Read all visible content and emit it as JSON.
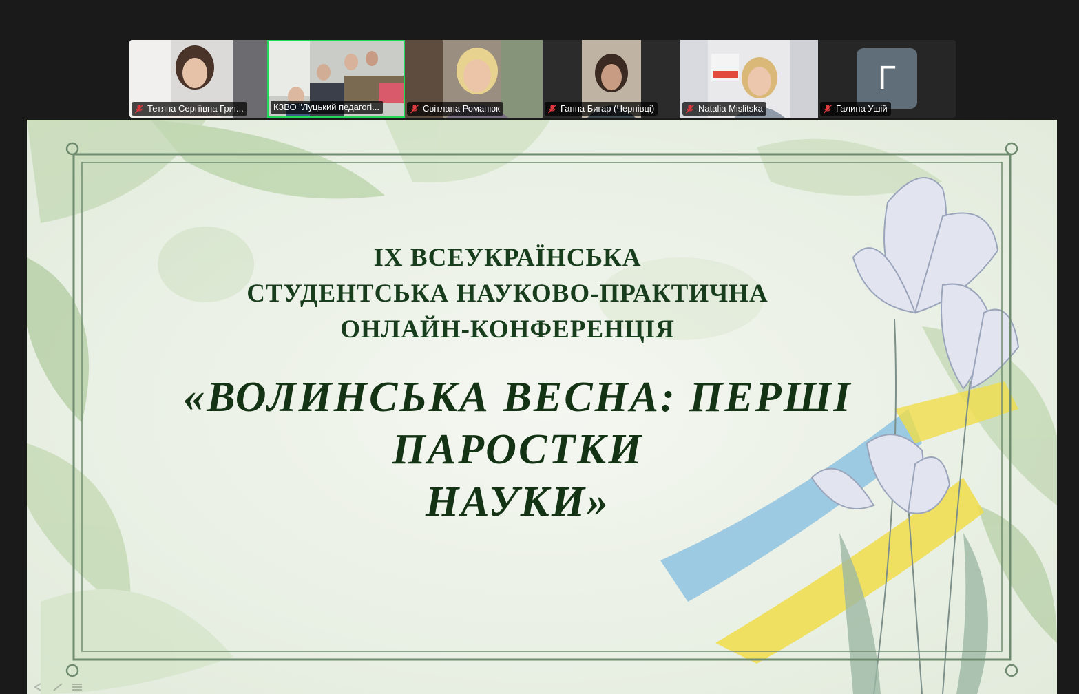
{
  "participants": [
    {
      "name": "Тетяна Сергіївна Григ...",
      "muted": true,
      "active": false
    },
    {
      "name": "КЗВО \"Луцький педагогі...",
      "muted": true,
      "active": true
    },
    {
      "name": "Світлана Романюк",
      "muted": true,
      "active": false
    },
    {
      "name": "Ганна Бигар (Чернівці)",
      "muted": true,
      "active": false
    },
    {
      "name": "Natalia Mislitska",
      "muted": true,
      "active": false
    },
    {
      "name": "Галина Ушій",
      "muted": true,
      "active": false,
      "avatar_letter": "Г"
    }
  ],
  "slide": {
    "line1": "IX ВСЕУКРАЇНСЬКА",
    "line2": "СТУДЕНТСЬКА НАУКОВО-ПРАКТИЧНА",
    "line3": "ОНЛАЙН-КОНФЕРЕНЦІЯ",
    "title_line1": "«ВОЛИНСЬКА  ВЕСНА: ПЕРШІ",
    "title_line2": "ПАРОСТКИ",
    "title_line3": "НАУКИ»"
  },
  "colors": {
    "active_border": "#23d959",
    "mute_icon": "#e0393e",
    "slide_text": "#173d1c",
    "frame": "#6f8b6f"
  }
}
